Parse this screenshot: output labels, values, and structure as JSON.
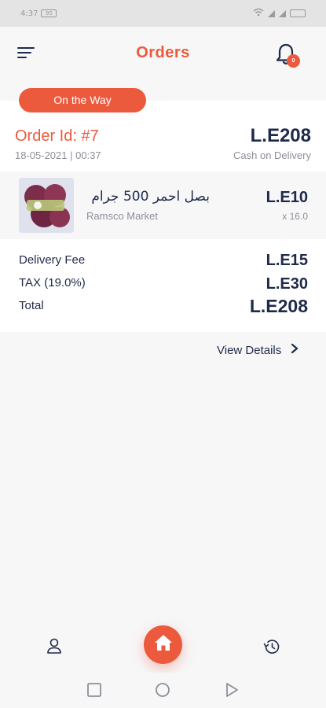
{
  "status_bar": {
    "left_text": "4:37",
    "battery": "95"
  },
  "header": {
    "title": "Orders",
    "notification_badge": "0"
  },
  "order": {
    "status": "On the Way",
    "id_label": "Order Id: #7",
    "datetime": "18-05-2021 | 00:37",
    "total": "L.E208",
    "payment_method": "Cash on Delivery",
    "items": [
      {
        "name": "بصل احمر 500 جرام",
        "store": "Ramsco Market",
        "price": "L.E10",
        "quantity": "x 16.0"
      }
    ],
    "summary": {
      "delivery_fee_label": "Delivery Fee",
      "delivery_fee_value": "L.E15",
      "tax_label": "TAX (19.0%)",
      "tax_value": "L.E30",
      "total_label": "Total",
      "total_value": "L.E208"
    },
    "view_details": "View Details"
  },
  "bottom_nav": {
    "items": [
      "profile-icon",
      "home-icon",
      "history-icon"
    ]
  },
  "colors": {
    "accent": "#ec5a3e",
    "text_dark": "#1e2a4a",
    "text_muted": "#8c8f99"
  }
}
